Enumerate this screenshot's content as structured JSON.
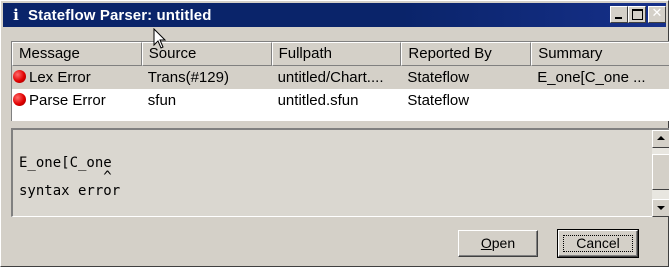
{
  "window": {
    "title": "Stateflow Parser: untitled",
    "title_icon": "i",
    "controls": {
      "minimize": "minimize-icon",
      "maximize": "maximize-icon",
      "close": "✕"
    }
  },
  "list": {
    "columns": [
      "Message",
      "Source",
      "Fullpath",
      "Reported By",
      "Summary"
    ],
    "rows": [
      {
        "icon": "error-icon",
        "message": "Lex Error",
        "source": "Trans(#129)",
        "fullpath": "untitled/Chart....",
        "reported_by": "Stateflow",
        "summary": "E_one[C_one ...",
        "selected": true
      },
      {
        "icon": "error-icon",
        "message": "Parse Error",
        "source": "sfun",
        "fullpath": "untitled.sfun",
        "reported_by": "Stateflow",
        "summary": "",
        "selected": false
      }
    ]
  },
  "detail": {
    "text": "E_one[C_one\n          ^\nsyntax error"
  },
  "buttons": {
    "open_label": "Open",
    "open_mnemonic": "O",
    "open_rest": "pen",
    "cancel_label": "Cancel"
  },
  "colors": {
    "titlebar": "#0a246a",
    "face": "#d4d0c8",
    "error": "#e00000"
  }
}
